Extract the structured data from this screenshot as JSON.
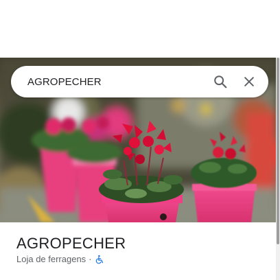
{
  "search": {
    "query": "AGROPECHER",
    "search_icon": "search-icon",
    "close_icon": "close-icon"
  },
  "photo": {
    "subject": "cyclamen-plants-photo"
  },
  "place": {
    "name": "AGROPECHER",
    "category": "Loja de ferragens",
    "separator": "·",
    "accessibility_icon": "wheelchair-icon"
  },
  "colors": {
    "accessibility_blue": "#1a73e8",
    "icon_gray": "#5f6368",
    "title_text": "#202124"
  }
}
